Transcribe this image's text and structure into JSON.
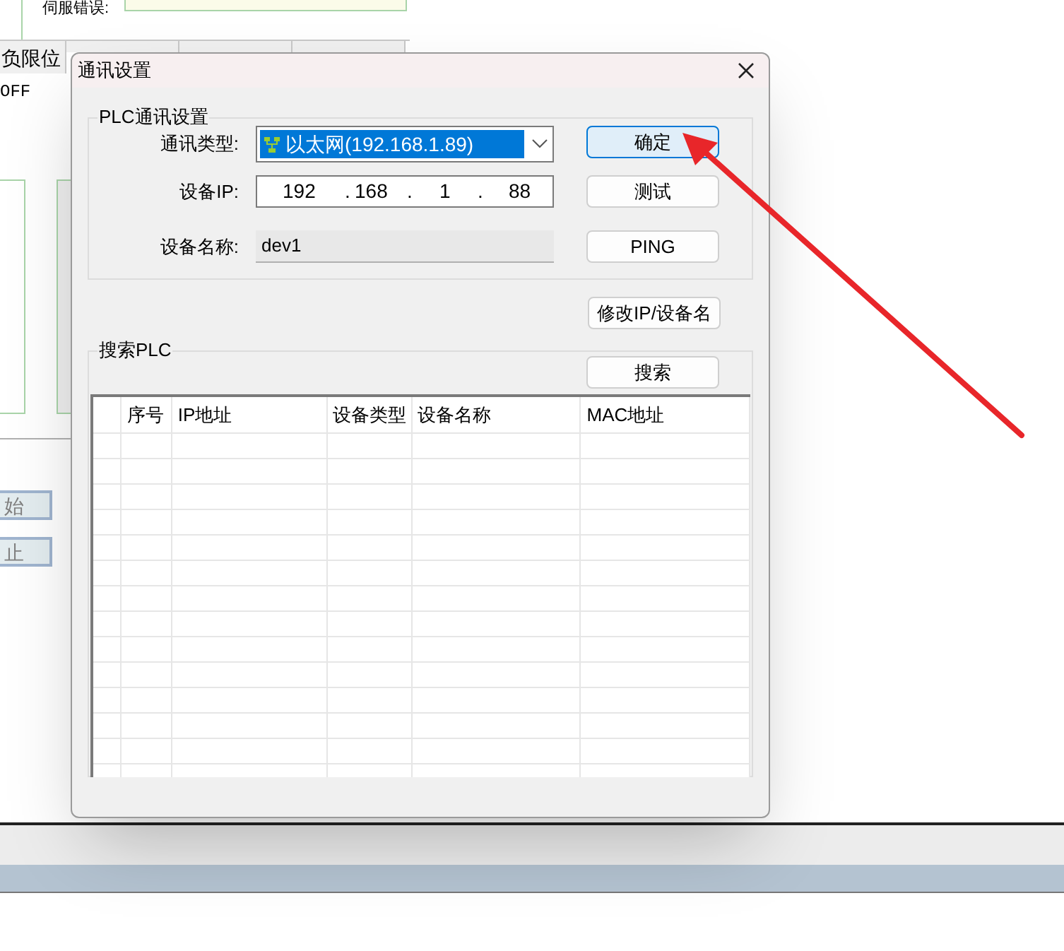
{
  "background_app": {
    "error_label": "伺服错误:",
    "tabs": [
      {
        "label": "负限位",
        "covered": false
      },
      {
        "covered": true
      },
      {
        "covered": true
      },
      {
        "covered": true
      }
    ],
    "status_value": "OFF",
    "buttons": [
      "始",
      "止"
    ]
  },
  "dialog": {
    "title": "通讯设置",
    "plc_group": {
      "title": "PLC通讯设置",
      "fields": [
        {
          "kind": "combo",
          "label": "通讯类型:",
          "value": "以太网(192.168.1.89)"
        },
        {
          "kind": "ip",
          "label": "设备IP:",
          "octets": [
            "192",
            "168",
            "1",
            "88"
          ],
          "separators": [
            ".",
            ".",
            "."
          ]
        },
        {
          "kind": "text",
          "label": "设备名称:",
          "value": "dev1",
          "disabled": true
        }
      ],
      "buttons": [
        {
          "label": "确定",
          "focused": true
        },
        {
          "label": "测试",
          "focused": false
        },
        {
          "label": "PING",
          "focused": false
        }
      ]
    },
    "modify_button": "修改IP/设备名",
    "search_group": {
      "title": "搜索PLC",
      "button": "搜索",
      "columns": [
        "序号",
        "IP地址",
        "设备类型",
        "设备名称",
        "MAC地址"
      ]
    }
  }
}
